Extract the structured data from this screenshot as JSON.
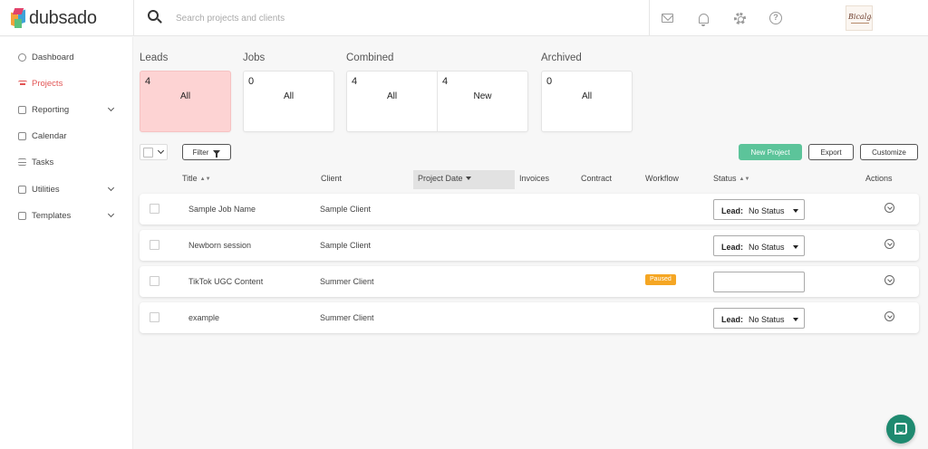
{
  "app": {
    "logo_text": "dubsado"
  },
  "search": {
    "placeholder": "Search projects and clients"
  },
  "header_icons": [
    "mail-icon",
    "bell-icon",
    "gear-icon",
    "help-icon"
  ],
  "avatar": {
    "signature_text": "Bicalgaro"
  },
  "sidebar": {
    "items": [
      {
        "label": "Dashboard",
        "icon": "dashboard-icon",
        "expandable": false,
        "active": false
      },
      {
        "label": "Projects",
        "icon": "projects-icon",
        "expandable": false,
        "active": true
      },
      {
        "label": "Reporting",
        "icon": "reporting-icon",
        "expandable": true,
        "active": false
      },
      {
        "label": "Calendar",
        "icon": "calendar-icon",
        "expandable": false,
        "active": false
      },
      {
        "label": "Tasks",
        "icon": "tasks-icon",
        "expandable": false,
        "active": false
      },
      {
        "label": "Utilities",
        "icon": "utilities-icon",
        "expandable": true,
        "active": false
      },
      {
        "label": "Templates",
        "icon": "templates-icon",
        "expandable": true,
        "active": false
      }
    ]
  },
  "groups": {
    "leads": {
      "label": "Leads",
      "cells": [
        {
          "count": "4",
          "label": "All"
        }
      ]
    },
    "jobs": {
      "label": "Jobs",
      "cells": [
        {
          "count": "0",
          "label": "All"
        }
      ]
    },
    "combined": {
      "label": "Combined",
      "cells": [
        {
          "count": "4",
          "label": "All"
        },
        {
          "count": "4",
          "label": "New"
        }
      ]
    },
    "archived": {
      "label": "Archived",
      "cells": [
        {
          "count": "0",
          "label": "All"
        }
      ]
    }
  },
  "toolbar": {
    "filter_label": "Filter",
    "new_project_label": "New Project",
    "export_label": "Export",
    "customize_label": "Customize"
  },
  "table": {
    "columns": {
      "title": "Title",
      "client": "Client",
      "project_date": "Project Date",
      "invoices": "Invoices",
      "contract": "Contract",
      "workflow": "Workflow",
      "status": "Status",
      "actions": "Actions"
    },
    "rows": [
      {
        "title": "Sample Job Name",
        "client": "Sample Client",
        "workflow_badge": "",
        "status_label": "Lead:",
        "status_value": "No Status"
      },
      {
        "title": "Newborn session",
        "client": "Sample Client",
        "workflow_badge": "",
        "status_label": "Lead:",
        "status_value": "No Status"
      },
      {
        "title": "TikTok UGC Content",
        "client": "Summer Client",
        "workflow_badge": "Paused",
        "status_label": "",
        "status_value": ""
      },
      {
        "title": "example",
        "client": "Summer Client",
        "workflow_badge": "",
        "status_label": "Lead:",
        "status_value": "No Status"
      }
    ]
  },
  "colors": {
    "accent_red": "#e25555",
    "leads_card_bg": "#fdd3d3",
    "new_project_green": "#5cc49a",
    "paused_orange": "#f5a623",
    "chat_green": "#1f8a70"
  }
}
